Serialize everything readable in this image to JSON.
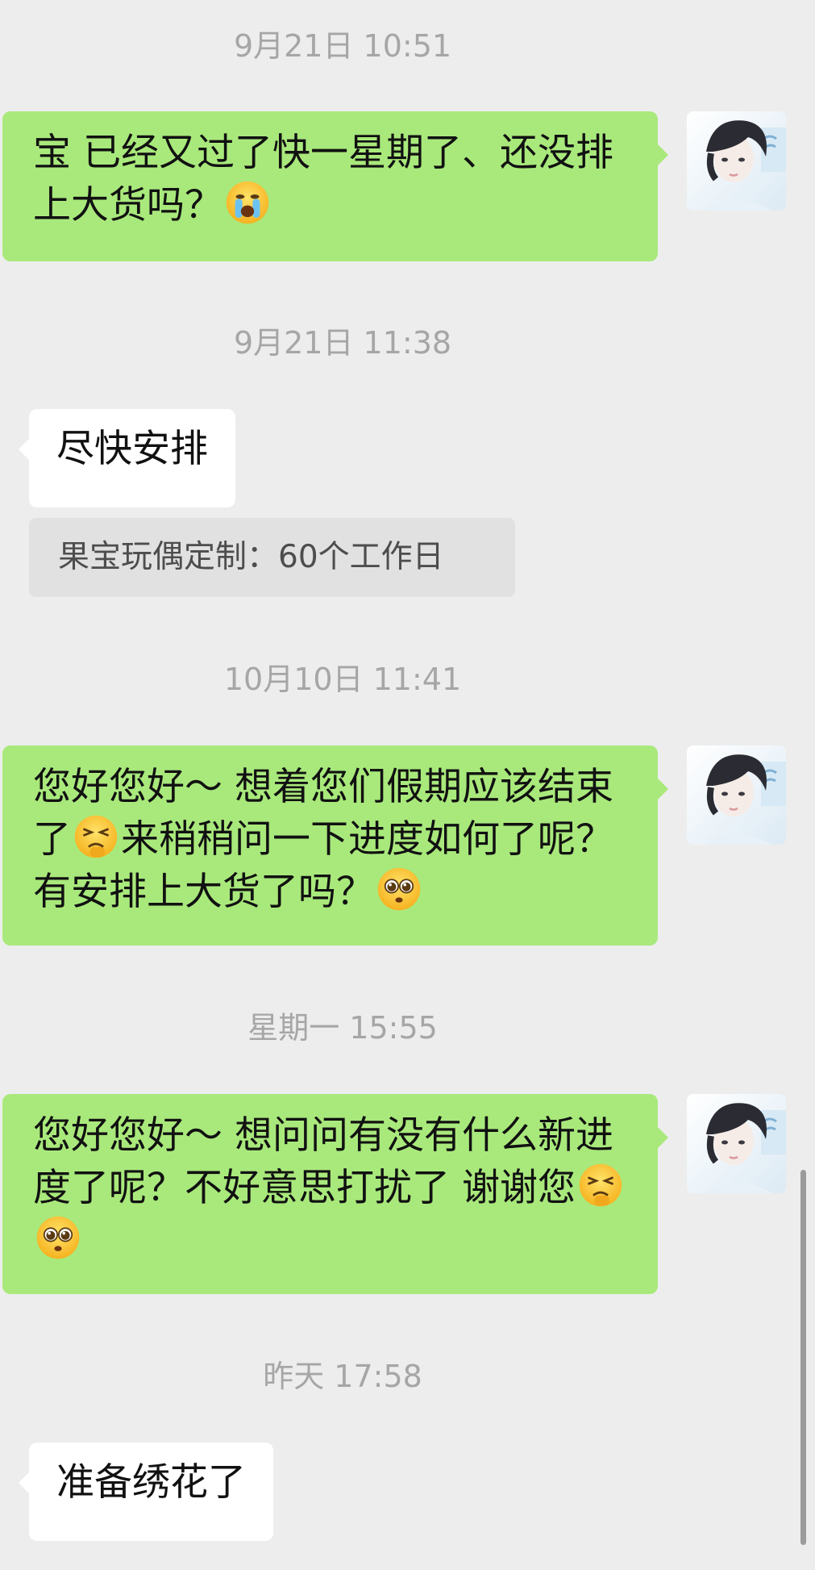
{
  "messages": [
    {
      "timestamp": "9月21日 10:51",
      "sent_text": "宝 已经又过了快一星期了、还没排上大货吗？"
    },
    {
      "timestamp": "9月21日 11:38",
      "received_text": "尽快安排",
      "note_text": "果宝玩偶定制：60个工作日"
    },
    {
      "timestamp": "10月10日 11:41",
      "sent_text_part1": "您好您好～ 想着您们假期应该结束了",
      "sent_text_part2": "来稍稍问一下进度如何了呢？有安排上大货了吗？"
    },
    {
      "timestamp": "星期一 15:55",
      "sent_text": "您好您好～ 想问问有没有什么新进度了呢？不好意思打扰了 谢谢您"
    },
    {
      "timestamp": "昨天 17:58",
      "received_text": "准备绣花了"
    }
  ],
  "icons": {
    "crying_emoji": "loudly-crying-face-emoji",
    "persevering_emoji": "persevering-face-emoji",
    "pleading_emoji": "pleading-face-emoji",
    "avatar": "user-avatar"
  },
  "colors": {
    "background": "#ededed",
    "sent_bubble": "#a9e97c",
    "received_bubble": "#ffffff",
    "note_background": "#e1e1e1",
    "timestamp_text": "#a6a6a6"
  }
}
